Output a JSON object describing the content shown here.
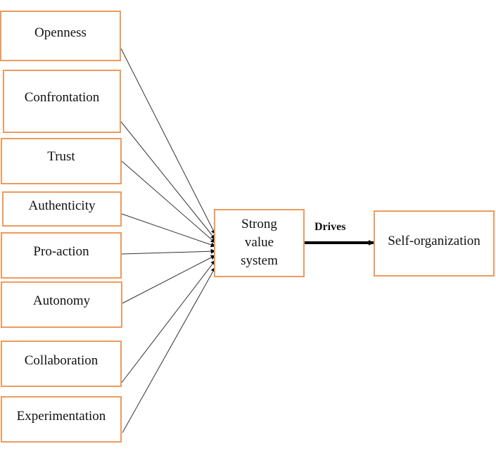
{
  "diagram": {
    "inputs": [
      {
        "id": "openness",
        "label": "Openness"
      },
      {
        "id": "confrontation",
        "label": "Confrontation"
      },
      {
        "id": "trust",
        "label": "Trust"
      },
      {
        "id": "authenticity",
        "label": "Authenticity"
      },
      {
        "id": "proaction",
        "label": "Pro-action"
      },
      {
        "id": "autonomy",
        "label": "Autonomy"
      },
      {
        "id": "collaboration",
        "label": "Collaboration"
      },
      {
        "id": "experimentation",
        "label": "Experimentation"
      }
    ],
    "center": {
      "label_lines": [
        "Strong",
        "value",
        "system"
      ]
    },
    "edge": {
      "label": "Drives"
    },
    "output": {
      "label": "Self-organization"
    },
    "colors": {
      "box_border": "#ED9B5F",
      "arrow": "#000000"
    }
  }
}
